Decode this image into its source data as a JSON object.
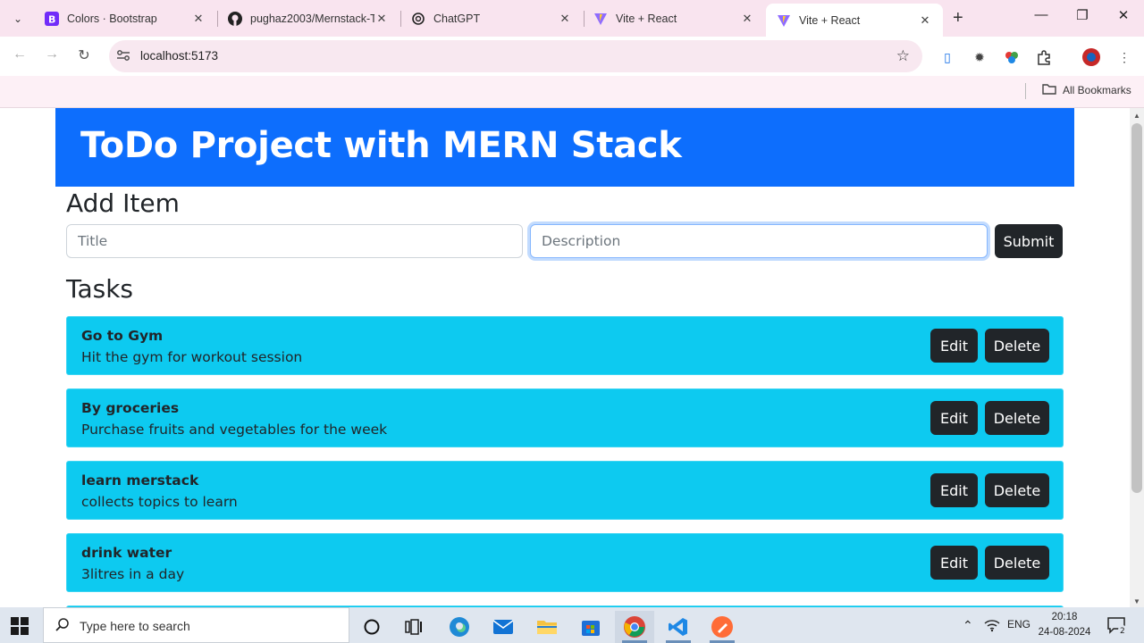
{
  "browser": {
    "tabs": [
      {
        "title": "Colors · Bootstrap",
        "icon": "bootstrap-icon"
      },
      {
        "title": "pughaz2003/Mernstack-T",
        "icon": "github-icon"
      },
      {
        "title": "ChatGPT",
        "icon": "chatgpt-icon"
      },
      {
        "title": "Vite + React",
        "icon": "vite-icon"
      },
      {
        "title": "Vite + React",
        "icon": "vite-icon",
        "active": true
      }
    ],
    "url": "localhost:5173",
    "bookmarks_label": "All Bookmarks"
  },
  "page": {
    "header_title": "ToDo Project with MERN Stack",
    "add_heading": "Add Item",
    "title_placeholder": "Title",
    "description_placeholder": "Description",
    "submit_label": "Submit",
    "tasks_heading": "Tasks",
    "edit_label": "Edit",
    "delete_label": "Delete",
    "tasks": [
      {
        "title": "Go to Gym",
        "description": "Hit the gym for workout session"
      },
      {
        "title": "By groceries",
        "description": "Purchase fruits and vegetables for the week"
      },
      {
        "title": "learn merstack",
        "description": "collects topics to learn"
      },
      {
        "title": "drink water",
        "description": "3litres in a day"
      }
    ]
  },
  "taskbar": {
    "search_placeholder": "Type here to search",
    "language": "ENG",
    "time": "20:18",
    "date": "24-08-2024",
    "notification_count": "2"
  },
  "colors": {
    "primary": "#0d6efd",
    "info": "#0dcaf0",
    "dark": "#212529",
    "tabstrip": "#f9e4ef"
  }
}
